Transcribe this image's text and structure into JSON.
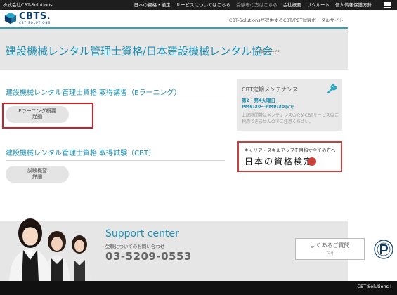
{
  "topbar": {
    "company": "株式会社CBT-Solutions",
    "nav": [
      "日本の資格・検定",
      "サービスについてはこちら",
      "受験者の方はこちら",
      "会社概要",
      "リクルート",
      "個人情報保護方針"
    ]
  },
  "header": {
    "logo_main": "CBTS.",
    "logo_sub": "CBT-SOLUTIONS",
    "tagline": "CBT-Solutionsが提供するCBT/PBT試験ポータルサイト"
  },
  "title_band": {
    "title": "建設機械レンタル管理士資格/日本建設機械レンタル協会",
    "subtitle": "一覧ページ"
  },
  "sections": {
    "elearning": {
      "title": "建設機械レンタル管理士資格 取得講習（Eラーニング）",
      "button_line1": "Eラーニング概要",
      "button_line2": "詳細"
    },
    "cbt": {
      "title": "建設機械レンタル管理士資格 取得試験（CBT）",
      "button_line1": "試験概要",
      "button_line2": "詳細"
    }
  },
  "maintenance": {
    "title": "CBT定期メンテナンス",
    "date_line1": "第2・第4火曜日",
    "date_line2": "PM6:30〜PM9:30まで",
    "note": "上記時間帯はメンテナンスのためCBTサービスはご利用できませんのでご注意ください。"
  },
  "kentei_banner": {
    "top_text": "キャリア・スキルアップを目指す全ての方へ",
    "main_text": "日本の資格検定"
  },
  "support": {
    "title": "Support center",
    "subtitle": "受験についてのお問い合わせ",
    "phone": "03-5209-0553"
  },
  "faq": {
    "label": "よくあるご質問",
    "label_en": "faq"
  },
  "footer": {
    "copyright": "CBT-Solutions I"
  },
  "colors": {
    "accent": "#1b8fb2",
    "highlight": "#d01f27",
    "topbar": "#1e1e1e"
  }
}
